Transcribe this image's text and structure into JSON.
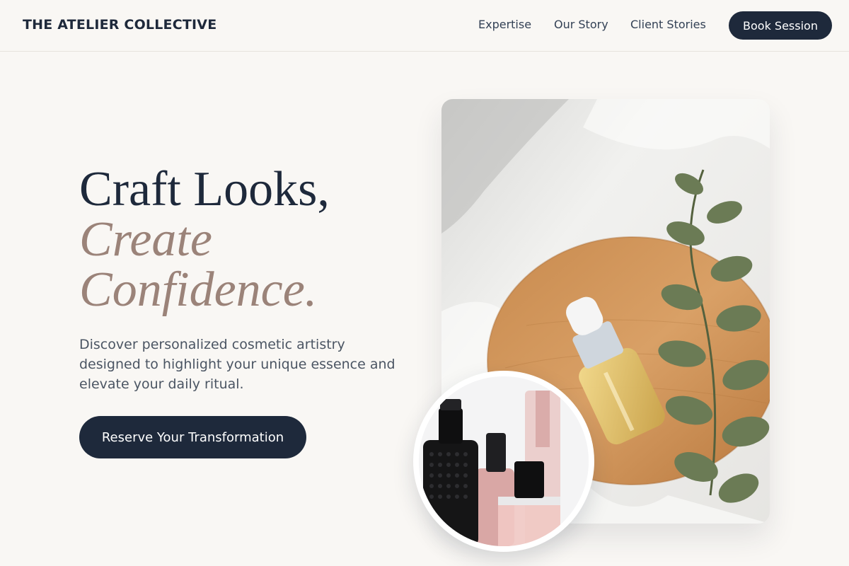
{
  "header": {
    "logo": "THE ATELIER COLLECTIVE",
    "nav": [
      "Expertise",
      "Our Story",
      "Client Stories"
    ],
    "book_label": "Book Session"
  },
  "hero": {
    "headline_line1": "Craft Looks,",
    "headline_line2": "Create",
    "headline_line3": "Confidence.",
    "description": "Discover personalized cosmetic artistry designed to highlight your unique essence and elevate your daily ritual.",
    "cta_label": "Reserve Your Transformation"
  },
  "images": {
    "main": "serum-bottle-on-wooden-tray-with-eucalyptus",
    "inset": "perfume-and-nail-polish-bottles"
  },
  "colors": {
    "primary": "#1e293b",
    "accent": "#9b8379",
    "background": "#f9f7f4",
    "body_text": "#4b5563"
  }
}
